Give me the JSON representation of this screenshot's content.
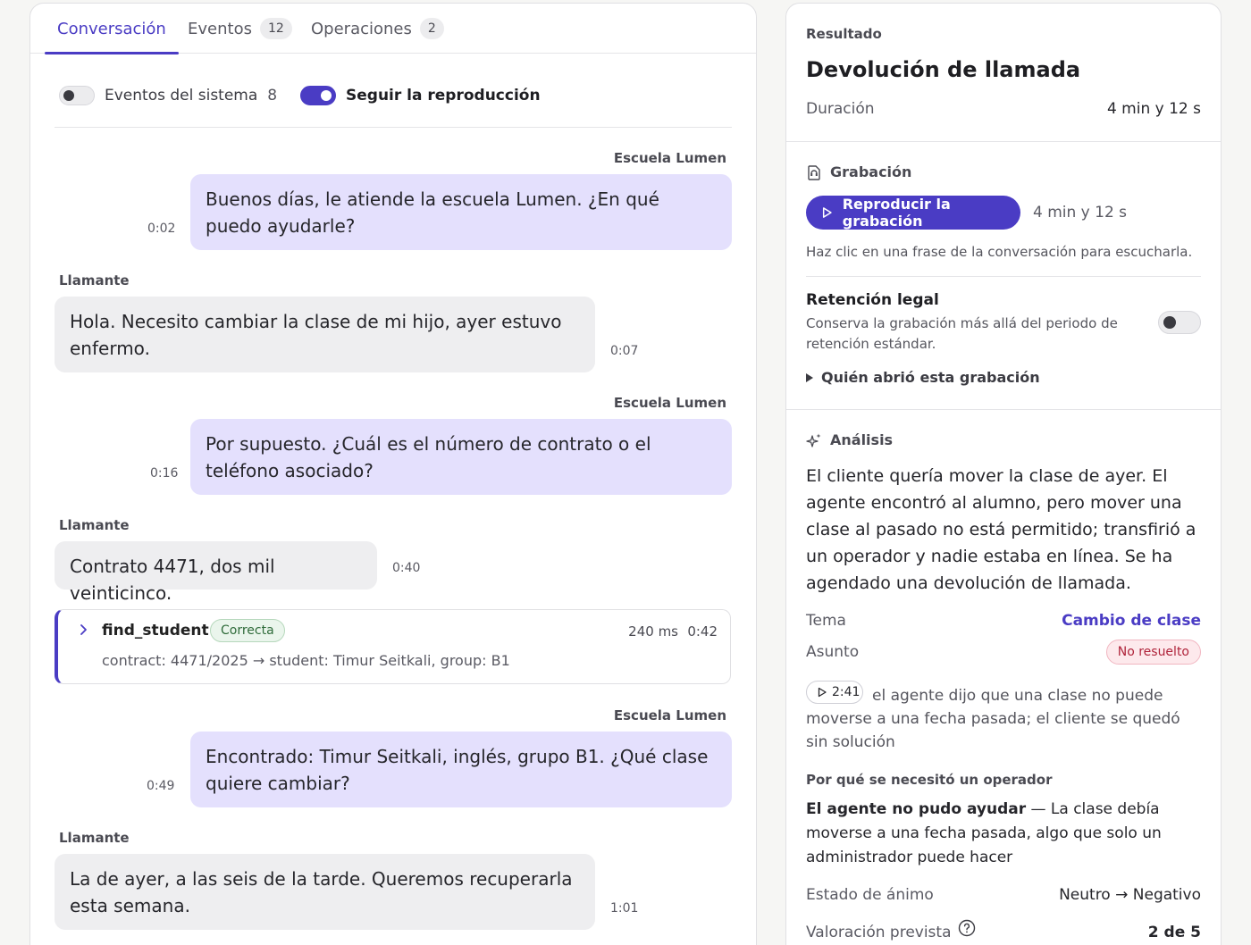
{
  "tabs": [
    {
      "label": "Conversación",
      "count": null
    },
    {
      "label": "Eventos",
      "count": "12"
    },
    {
      "label": "Operaciones",
      "count": "2"
    }
  ],
  "toggles": {
    "system_events_label": "Eventos del sistema",
    "system_events_count": "8",
    "system_events_on": false,
    "follow_playback_label": "Seguir la reproducción",
    "follow_playback_on": true
  },
  "conversation": [
    {
      "speaker": "Escuela Lumen",
      "role": "agent",
      "time": "0:02",
      "text": "Buenos días, le atiende la escuela Lumen. ¿En qué puedo ayudarle?"
    },
    {
      "speaker": "Llamante",
      "role": "caller",
      "time": "0:07",
      "text": "Hola. Necesito cambiar la clase de mi hijo, ayer estuvo enfermo."
    },
    {
      "speaker": "Escuela Lumen",
      "role": "agent",
      "time": "0:16",
      "text": "Por supuesto. ¿Cuál es el número de contrato o el teléfono asociado?"
    },
    {
      "speaker": "Llamante",
      "role": "caller",
      "time": "0:40",
      "text": "Contrato 4471, dos mil veinticinco."
    },
    {
      "speaker": "Escuela Lumen",
      "role": "agent",
      "time": "0:49",
      "text": "Encontrado: Timur Seitkali, inglés, grupo B1. ¿Qué clase quiere cambiar?"
    },
    {
      "speaker": "Llamante",
      "role": "caller",
      "time": "1:01",
      "text": "La de ayer, a las seis de la tarde. Queremos recuperarla esta semana."
    }
  ],
  "tool_call": {
    "name": "find_student",
    "status": "Correcta",
    "duration": "240 ms",
    "time": "0:42",
    "detail": "contract: 4471/2025 → student: Timur Seitkali, group: B1"
  },
  "result": {
    "label": "Resultado",
    "title": "Devolución de llamada",
    "duration_label": "Duración",
    "duration_value": "4 min y 12 s"
  },
  "recording": {
    "label": "Grabación",
    "play_label": "Reproducir la grabación",
    "length": "4 min y 12 s",
    "hint": "Haz clic en una frase de la conversación para escucharla.",
    "retention_title": "Retención legal",
    "retention_desc": "Conserva la grabación más allá del periodo de retención estándar.",
    "retention_on": false,
    "who_opened": "Quién abrió esta grabación"
  },
  "analysis": {
    "label": "Análisis",
    "summary": "El cliente quería mover la clase de ayer. El agente encontró al alumno, pero mover una clase al pasado no está permitido; transfirió a un operador y nadie estaba en línea. Se ha agendado una devolución de llamada.",
    "topic_label": "Tema",
    "topic_value": "Cambio de clase",
    "subject_label": "Asunto",
    "subject_value": "No resuelto",
    "timestamp": "2:41",
    "timestamp_text": "el agente dijo que una clase no puede moverse a una fecha pasada; el cliente se quedó sin solución",
    "why_label": "Por qué se necesitó un operador",
    "why_bold": "El agente no pudo ayudar",
    "why_text": " — La clase debía moverse a una fecha pasada, algo que solo un administrador puede hacer",
    "mood_label": "Estado de ánimo",
    "mood_value": "Neutro → Negativo",
    "rating_label": "Valoración prevista",
    "rating_value": "2 de 5"
  },
  "colors": {
    "accent": "#4a3cc4",
    "agent_bubble": "#e4e0fd",
    "caller_bubble": "#eeeef0",
    "success": "#2f6b3a",
    "danger": "#b0243b"
  }
}
